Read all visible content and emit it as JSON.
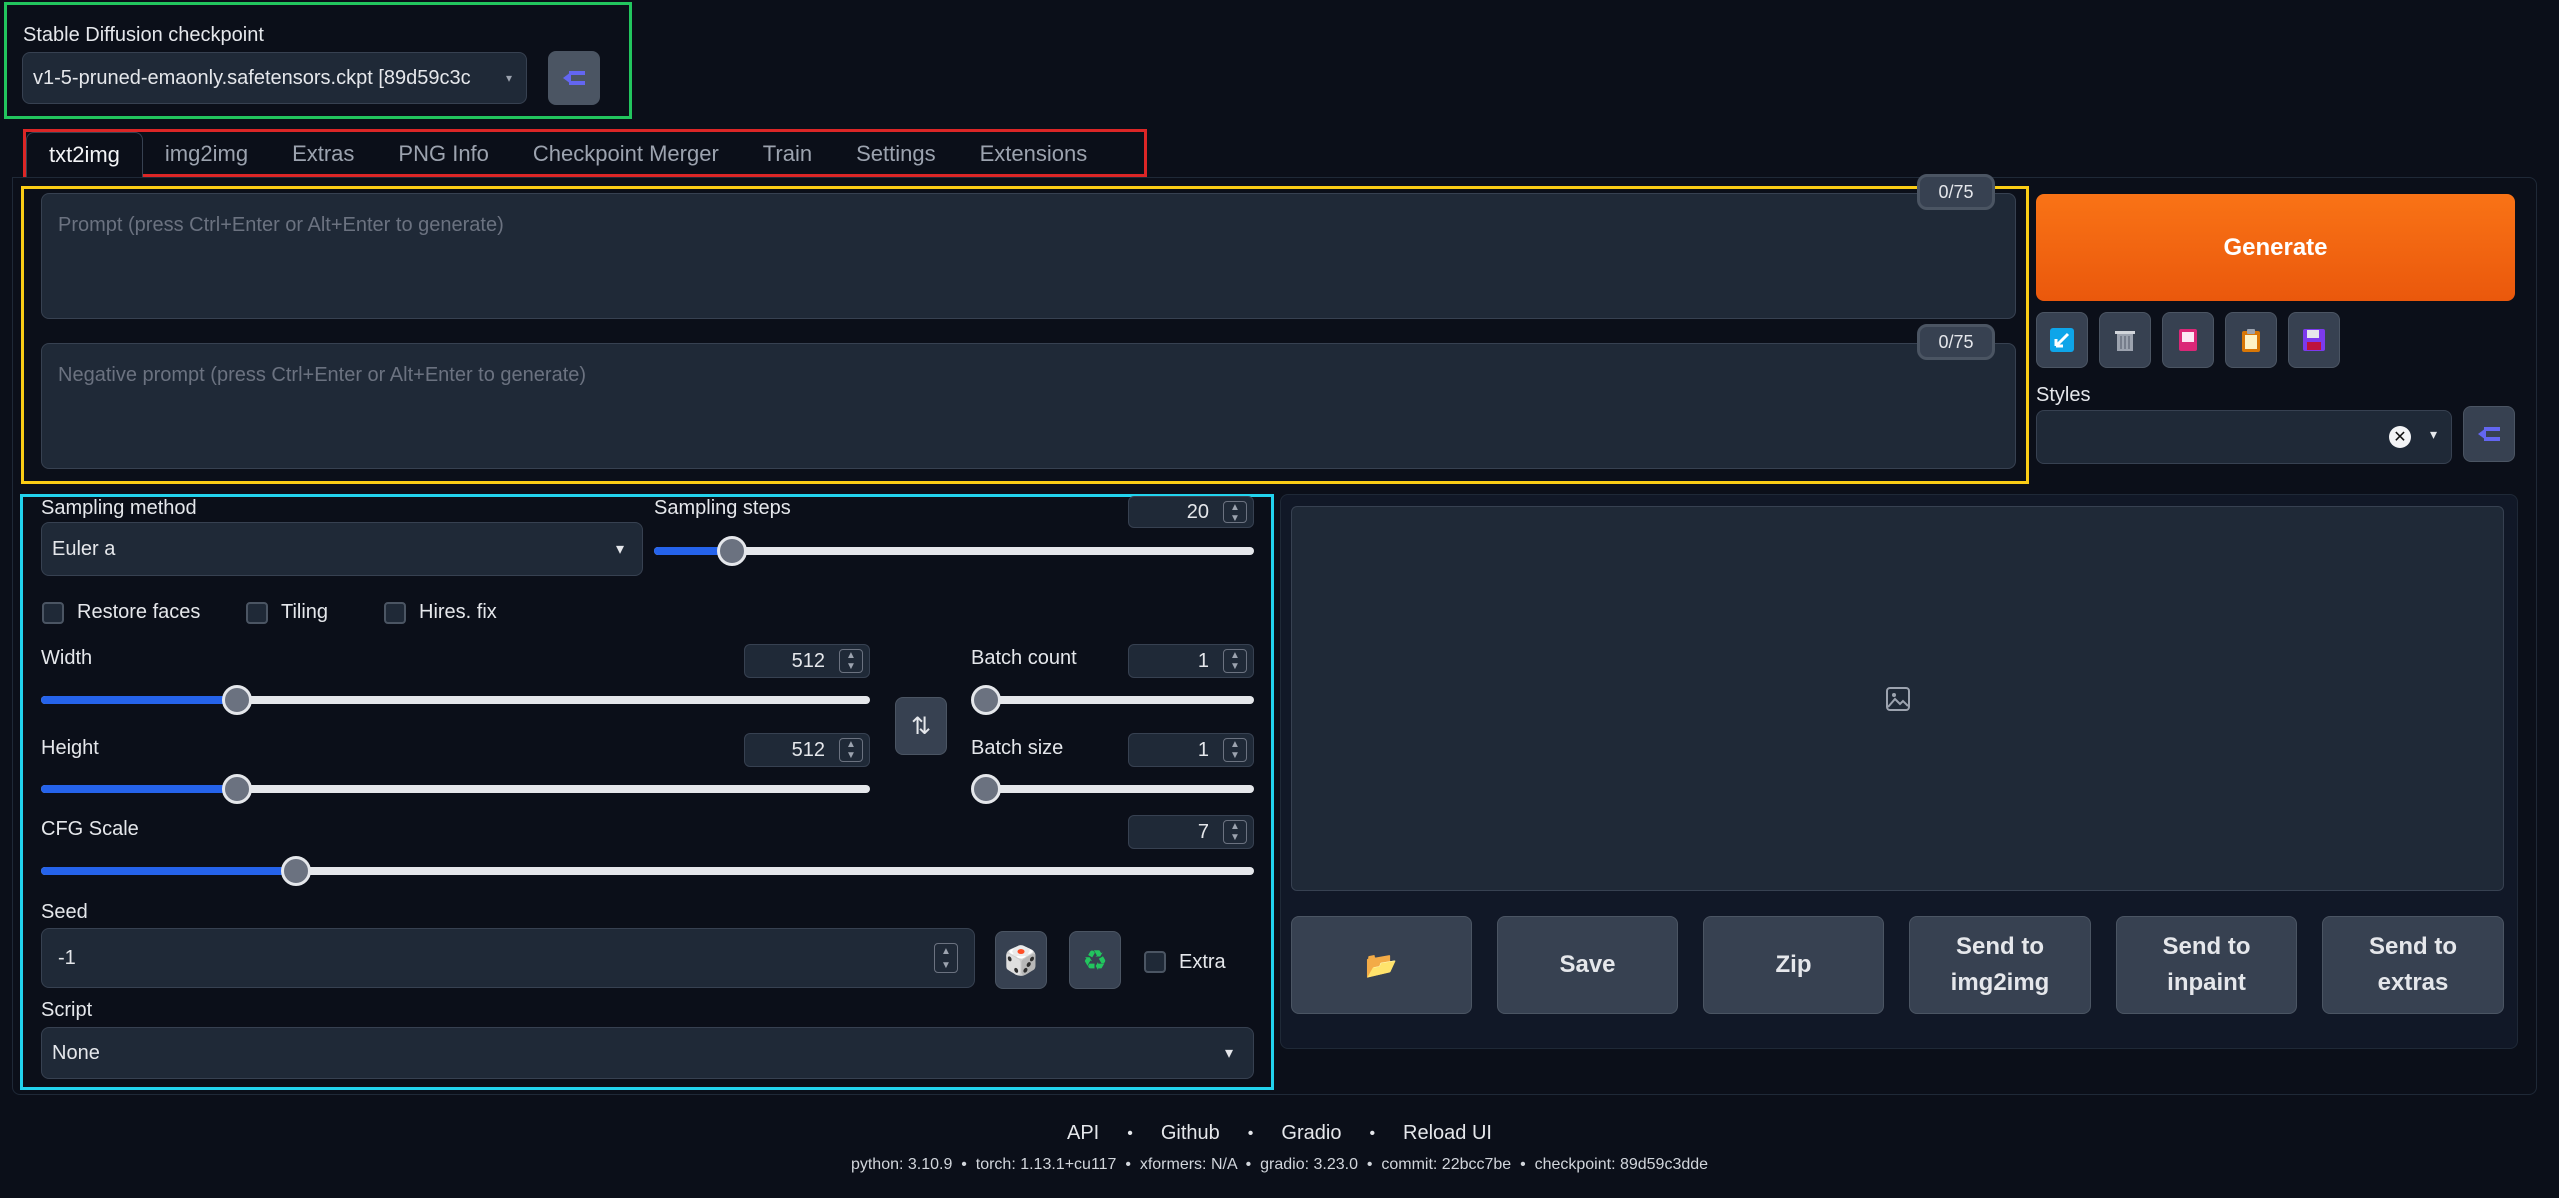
{
  "checkpoint": {
    "label": "Stable Diffusion checkpoint",
    "value": "v1-5-pruned-emaonly.safetensors.ckpt [89d59c3c"
  },
  "tabs": [
    "txt2img",
    "img2img",
    "Extras",
    "PNG Info",
    "Checkpoint Merger",
    "Train",
    "Settings",
    "Extensions"
  ],
  "prompt": {
    "placeholder": "Prompt (press Ctrl+Enter or Alt+Enter to generate)",
    "counter": "0/75"
  },
  "negative_prompt": {
    "placeholder": "Negative prompt (press Ctrl+Enter or Alt+Enter to generate)",
    "counter": "0/75"
  },
  "generate_label": "Generate",
  "styles_label": "Styles",
  "sampling": {
    "method_label": "Sampling method",
    "method_value": "Euler a",
    "steps_label": "Sampling steps",
    "steps_value": "20",
    "steps_fraction": 0.13
  },
  "checkboxes": {
    "restore_faces": "Restore faces",
    "tiling": "Tiling",
    "hires_fix": "Hires. fix"
  },
  "width": {
    "label": "Width",
    "value": "512",
    "fraction": 0.236
  },
  "height": {
    "label": "Height",
    "value": "512",
    "fraction": 0.236
  },
  "batch_count": {
    "label": "Batch count",
    "value": "1",
    "fraction": 0
  },
  "batch_size": {
    "label": "Batch size",
    "value": "1",
    "fraction": 0
  },
  "cfg": {
    "label": "CFG Scale",
    "value": "7",
    "fraction": 0.21
  },
  "seed": {
    "label": "Seed",
    "value": "-1",
    "extra_label": "Extra"
  },
  "script": {
    "label": "Script",
    "value": "None"
  },
  "output_buttons": {
    "save": "Save",
    "zip": "Zip",
    "send_img2img": "Send to img2img",
    "send_inpaint": "Send to inpaint",
    "send_extras": "Send to extras"
  },
  "footer": {
    "links": [
      "API",
      "Github",
      "Gradio",
      "Reload UI"
    ],
    "version_info": "python: 3.10.9  •  torch: 1.13.1+cu117  •  xformers: N/A  •  gradio: 3.23.0  •  commit: 22bcc7be  •  checkpoint: 89d59c3dde"
  },
  "colors": {
    "accent_orange": "#f97316",
    "slider_blue": "#2563eb",
    "background": "#0b0f19",
    "annotation_green": "#22c55e",
    "annotation_red": "#dc2626",
    "annotation_yellow": "#facc15",
    "annotation_cyan": "#22d3ee"
  }
}
